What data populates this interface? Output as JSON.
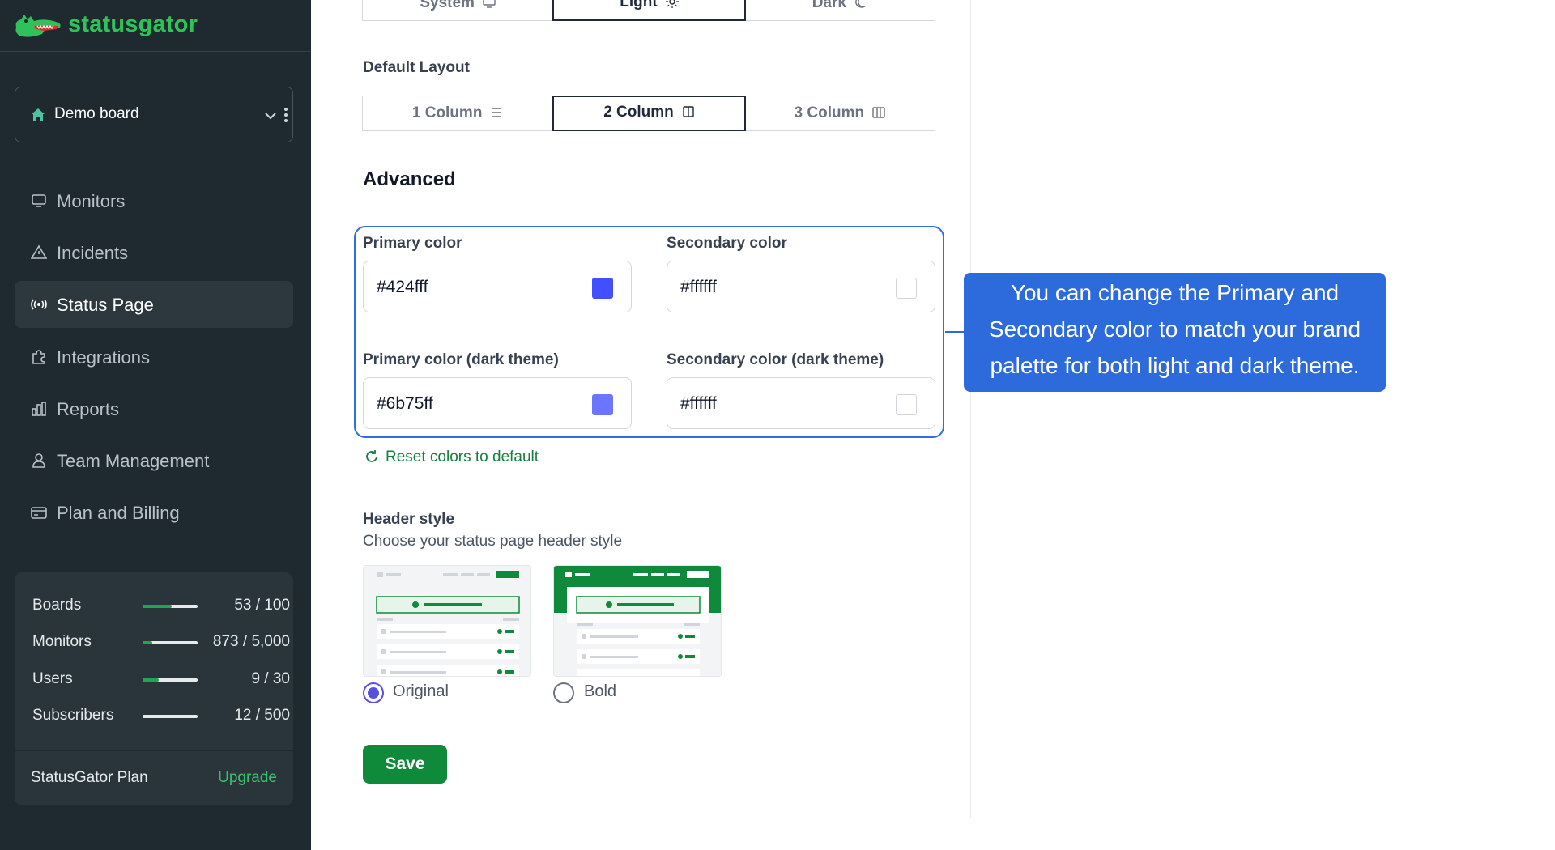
{
  "app": {
    "name": "statusgator"
  },
  "sidebar": {
    "board": {
      "name": "Demo board"
    },
    "items": [
      {
        "label": "Monitors",
        "icon": "monitor-icon"
      },
      {
        "label": "Incidents",
        "icon": "warning-triangle-icon"
      },
      {
        "label": "Status Page",
        "icon": "broadcast-icon",
        "active": true
      },
      {
        "label": "Integrations",
        "icon": "puzzle-icon"
      },
      {
        "label": "Reports",
        "icon": "bar-chart-icon"
      },
      {
        "label": "Team Management",
        "icon": "user-icon"
      },
      {
        "label": "Plan and Billing",
        "icon": "credit-card-icon"
      }
    ],
    "usage": [
      {
        "label": "Boards",
        "value": "53 / 100",
        "fraction": 0.53
      },
      {
        "label": "Monitors",
        "value": "873 / 5,000",
        "fraction": 0.17
      },
      {
        "label": "Users",
        "value": "9 / 30",
        "fraction": 0.3
      },
      {
        "label": "Subscribers",
        "value": "12 / 500",
        "fraction": 0.02
      }
    ],
    "plan": {
      "label": "StatusGator Plan",
      "upgrade": "Upgrade"
    }
  },
  "theme": {
    "options": [
      "System",
      "Light",
      "Dark"
    ],
    "selected": "Light"
  },
  "layout": {
    "label": "Default Layout",
    "options": [
      "1 Column",
      "2 Column",
      "3 Column"
    ],
    "selected": "2 Column"
  },
  "advanced": {
    "heading": "Advanced",
    "primary_label": "Primary color",
    "primary_value": "#424fff",
    "secondary_label": "Secondary color",
    "secondary_value": "#ffffff",
    "primary_dark_label": "Primary color (dark theme)",
    "primary_dark_value": "#6b75ff",
    "secondary_dark_label": "Secondary color (dark theme)",
    "secondary_dark_value": "#ffffff",
    "reset_label": "Reset colors to default"
  },
  "header_style": {
    "label": "Header style",
    "sub": "Choose your status page header style",
    "options": [
      "Original",
      "Bold"
    ],
    "selected": "Original"
  },
  "save_label": "Save",
  "tooltip": {
    "line1": "You can change the Primary and",
    "line2": "Secondary color to match your brand",
    "line3": "palette for both light and dark theme."
  },
  "colors": {
    "brand_green": "#2fc25a",
    "sidebar_bg": "#1f2a30",
    "primary_swatch": "#424fff",
    "primary_dark_swatch": "#6b75ff",
    "tooltip_bg": "#2d6bdc",
    "save_bg": "#0f8a3a"
  }
}
